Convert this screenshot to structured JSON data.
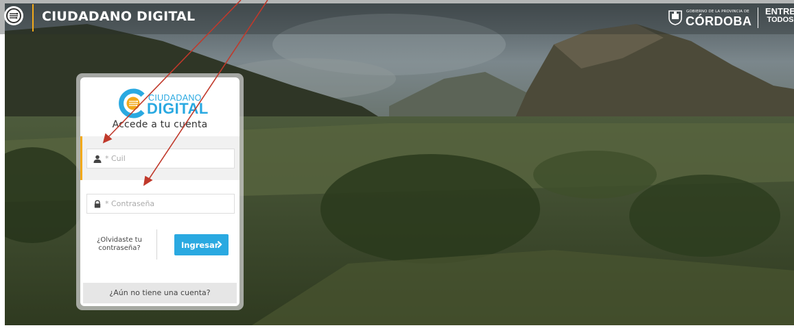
{
  "header": {
    "title": "CIUDADANO DIGITAL",
    "gov_small": "GOBIERNO DE LA PROVINCIA DE",
    "gov_name": "CÓRDOBA",
    "slogan_line1": "ENTRE",
    "slogan_line2": "TODOS",
    "accent_color": "#f2a91a"
  },
  "login": {
    "logo_word1": "CIUDADANO",
    "logo_word2": "DIGITAL",
    "heading": "Accede a tu cuenta",
    "cuil_placeholder": "* Cuil",
    "cuil_icon": "user-icon",
    "password_placeholder": "* Contraseña",
    "password_icon": "lock-icon",
    "forgot_line1": "¿Olvidaste tu",
    "forgot_line2": "contraseña?",
    "submit_label": "Ingresar",
    "submit_icon": "chevron-right-icon",
    "signup_label": "¿Aún no tiene una cuenta?",
    "brand_color": "#2aa9e1"
  },
  "annotations": {
    "arrow_color": "#c0392b"
  }
}
